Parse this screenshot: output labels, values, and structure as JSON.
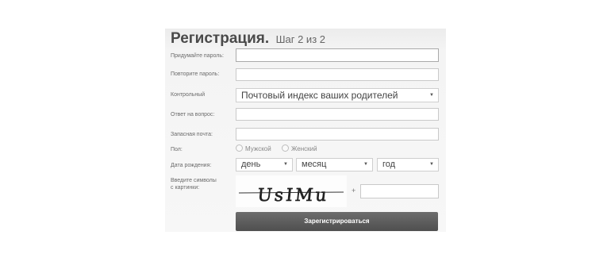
{
  "header": {
    "title": "Регистрация.",
    "step": "Шаг 2 из 2"
  },
  "form": {
    "password_label": "Придумайте пароль:",
    "password_value": "",
    "repeat_label": "Повторите пароль:",
    "repeat_value": "",
    "question_label": "Контрольный",
    "question_selected": "Почтовый индекс ваших родителей",
    "answer_label": "Ответ на вопрос:",
    "answer_value": "",
    "backup_email_label": "Запасная почта:",
    "backup_email_value": "",
    "gender_label": "Пол:",
    "gender_male": "Мужской",
    "gender_female": "Женский",
    "birthdate_label": "Дата рождения:",
    "day_placeholder": "день",
    "month_placeholder": "месяц",
    "year_placeholder": "год",
    "captcha_label_line1": "Введите символы",
    "captcha_label_line2": "с картинки:",
    "captcha_text": "UsIMu",
    "captcha_plus": "+",
    "captcha_value": "",
    "submit_label": "Зарегистрироваться"
  },
  "icons": {
    "dropdown": "chevron-down-icon"
  }
}
